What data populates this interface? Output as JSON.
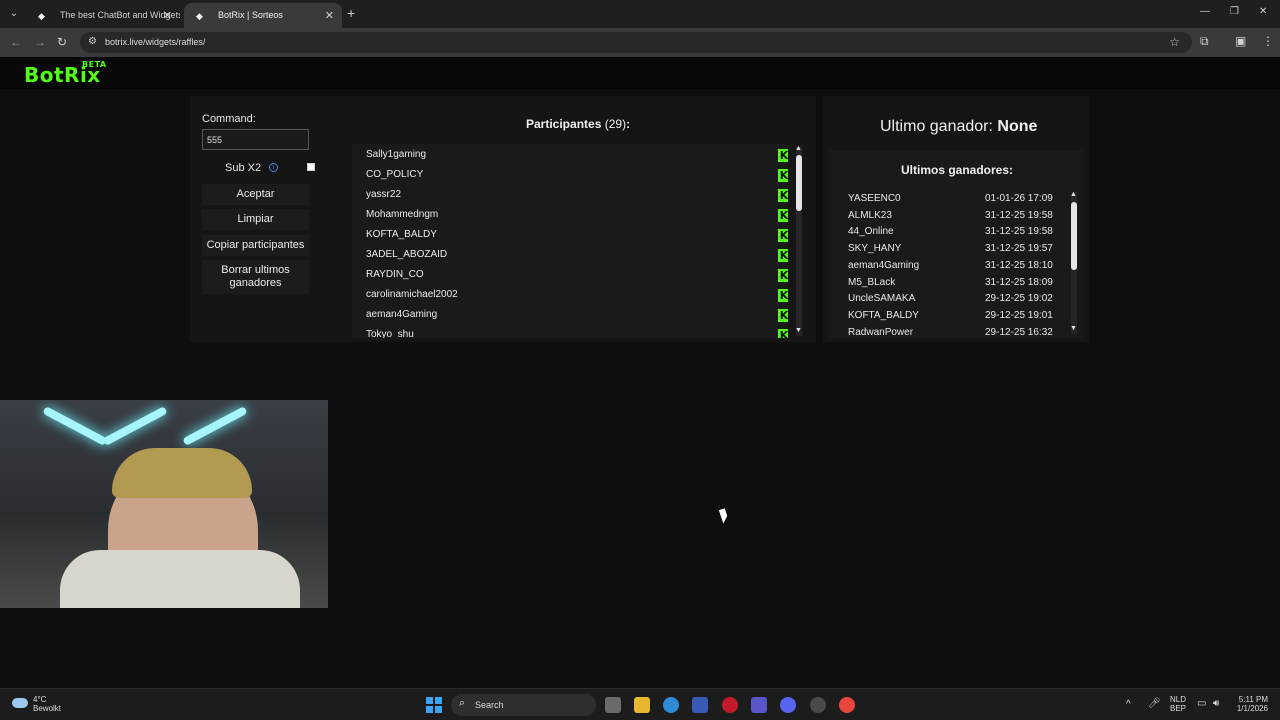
{
  "browser": {
    "tabs": [
      {
        "title": "The best ChatBot and Widgets",
        "active": false
      },
      {
        "title": "BotRix | Sorteos",
        "active": true
      }
    ],
    "url": "botrix.live/widgets/raffles/"
  },
  "site": {
    "logo": "BotRix",
    "logo_badge": "BETA"
  },
  "controls": {
    "command_label": "Command:",
    "command_value": "555",
    "sub_label": "Sub X2",
    "info_glyph": "i",
    "accept_label": "Aceptar",
    "clear_label": "Limpiar",
    "copy_label": "Copiar participantes",
    "delete_label": "Borrar ultimos ganadores"
  },
  "participants": {
    "heading_label": "Participantes",
    "count": "(29)",
    "suffix": ":",
    "platform_icon": "kick-icon",
    "items": [
      "Sally1gaming",
      "CO_POLICY",
      "yassr22",
      "Mohammedngm",
      "KOFTA_BALDY",
      "3ADEL_ABOZAID",
      "RAYDIN_CO",
      "carolinamichael2002",
      "aeman4Gaming",
      "Tokyo_shu"
    ]
  },
  "winner": {
    "label": "Ultimo ganador:",
    "value": "None"
  },
  "winners": {
    "heading": "Ultimos ganadores:",
    "rows": [
      {
        "name": "YASEENC0",
        "date": "01-01-26 17:09"
      },
      {
        "name": "ALMLK23",
        "date": "31-12-25 19:58"
      },
      {
        "name": "44_Online",
        "date": "31-12-25 19:58"
      },
      {
        "name": "SKY_HANY",
        "date": "31-12-25 19:57"
      },
      {
        "name": "aeman4Gaming",
        "date": "31-12-25 18:10"
      },
      {
        "name": "M5_BLack",
        "date": "31-12-25 18:09"
      },
      {
        "name": "UncleSAMAKA",
        "date": "29-12-25 19:02"
      },
      {
        "name": "KOFTA_BALDY",
        "date": "29-12-25 19:01"
      },
      {
        "name": "RadwanPower",
        "date": "29-12-25 16:32"
      }
    ]
  },
  "taskbar": {
    "temperature": "4°C",
    "weather": "Bewolkt",
    "search": "Search",
    "lang_1": "NLD",
    "lang_2": "BEP",
    "time": "5:11 PM",
    "date": "1/1/2026"
  },
  "colors": {
    "accent": "#53fc18",
    "info": "#3a8ee6",
    "page_bg": "#0e0e0e"
  }
}
